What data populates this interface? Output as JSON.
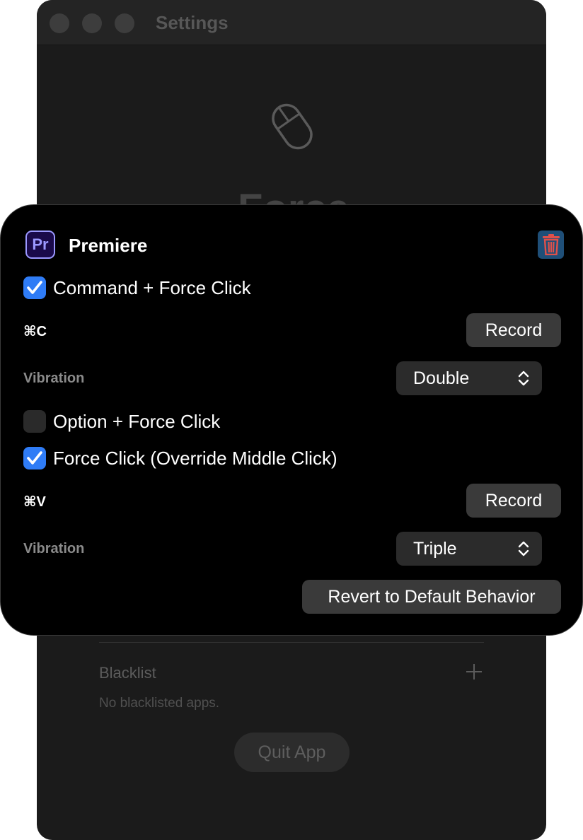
{
  "window": {
    "title": "Settings",
    "app_heading": "Force"
  },
  "blacklist": {
    "label": "Blacklist",
    "empty_text": "No blacklisted apps."
  },
  "quit_label": "Quit App",
  "card": {
    "app_name": "Premiere",
    "app_icon_text": "Pr",
    "rules": [
      {
        "label": "Command + Force Click",
        "checked": true,
        "shortcut": "⌘C",
        "record_label": "Record",
        "vibration_label": "Vibration",
        "vibration": "Double"
      },
      {
        "label": "Option + Force Click",
        "checked": false
      },
      {
        "label": "Force Click (Override Middle Click)",
        "checked": true,
        "shortcut": "⌘V",
        "record_label": "Record",
        "vibration_label": "Vibration",
        "vibration": "Triple"
      }
    ],
    "revert_label": "Revert to Default Behavior"
  },
  "colors": {
    "accent_checkbox": "#2f7cf6",
    "trash_icon": "#e0504a",
    "premiere_purple": "#9b98ff"
  }
}
